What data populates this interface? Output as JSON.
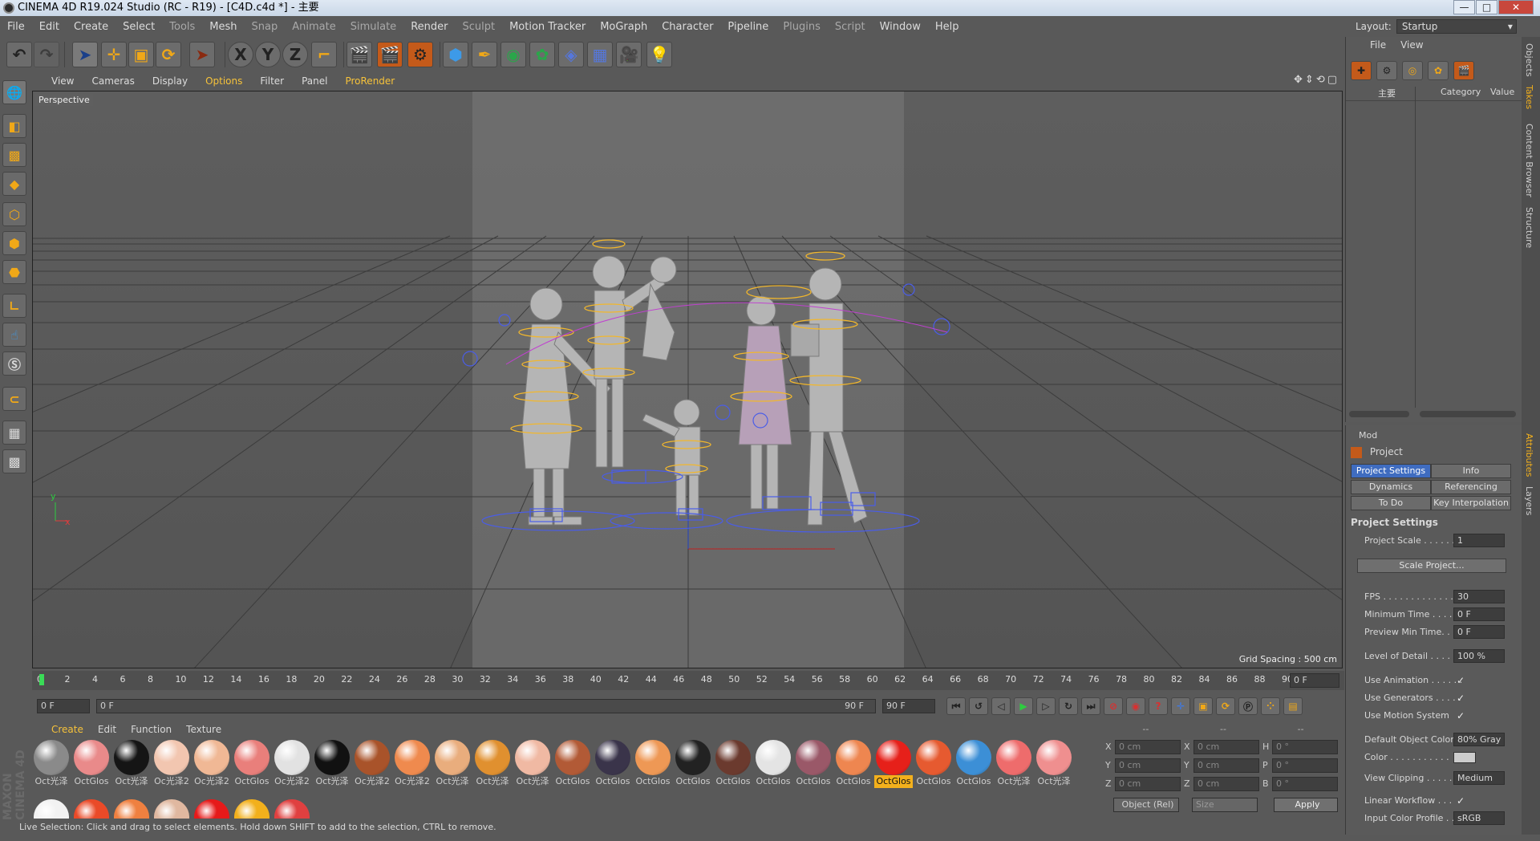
{
  "window": {
    "title": "CINEMA 4D R19.024 Studio (RC - R19) - [C4D.c4d *] - 主要",
    "controls": [
      "—",
      "□",
      "✕"
    ]
  },
  "menubar": {
    "items": [
      "File",
      "Edit",
      "Create",
      "Select",
      "Tools",
      "Mesh",
      "Snap",
      "Animate",
      "Simulate",
      "Render",
      "Sculpt",
      "Motion Tracker",
      "MoGraph",
      "Character",
      "Pipeline",
      "Plugins",
      "Script",
      "Window",
      "Help"
    ],
    "layout_label": "Layout:",
    "layout_value": "Startup"
  },
  "toolbar": {
    "axis_x": "X",
    "axis_y": "Y",
    "axis_z": "Z"
  },
  "viewport": {
    "menu": [
      "View",
      "Cameras",
      "Display",
      "Options",
      "Filter",
      "Panel",
      "ProRender"
    ],
    "camera_label": "Perspective",
    "grid_spacing": "Grid Spacing : 500 cm",
    "axis_y": "y",
    "axis_x": "x"
  },
  "timeline": {
    "ticks": [
      "0",
      "2",
      "4",
      "6",
      "8",
      "10",
      "12",
      "14",
      "16",
      "18",
      "20",
      "22",
      "24",
      "26",
      "28",
      "30",
      "32",
      "34",
      "36",
      "38",
      "40",
      "42",
      "44",
      "46",
      "48",
      "50",
      "52",
      "54",
      "56",
      "58",
      "60",
      "62",
      "64",
      "66",
      "68",
      "70",
      "72",
      "74",
      "76",
      "78",
      "80",
      "82",
      "84",
      "86",
      "88",
      "90"
    ],
    "current_frame": "0 F",
    "start_field": "0 F",
    "range_start": "0 F",
    "range_end": "90 F",
    "end_field": "90 F"
  },
  "material_manager": {
    "menu": [
      "Create",
      "Edit",
      "Function",
      "Texture"
    ],
    "materials": [
      {
        "label": "Oct光泽",
        "color": "#8a8a8a",
        "selected": false
      },
      {
        "label": "OctGlos",
        "color": "#e98a8a",
        "selected": false
      },
      {
        "label": "Oct光泽",
        "color": "#151515",
        "selected": false
      },
      {
        "label": "Oc光泽2",
        "color": "#f2c6b0",
        "selected": false
      },
      {
        "label": "Oc光泽2",
        "color": "#f0b895",
        "selected": false
      },
      {
        "label": "OctGlos",
        "color": "#e97f7b",
        "selected": false
      },
      {
        "label": "Oc光泽2",
        "color": "#e2e2e2",
        "selected": false
      },
      {
        "label": "Oct光泽",
        "color": "#111111",
        "selected": false
      },
      {
        "label": "Oc光泽2",
        "color": "#a9532a",
        "selected": false
      },
      {
        "label": "Oc光泽2",
        "color": "#ef8a4e",
        "selected": false
      },
      {
        "label": "Oct光泽",
        "color": "#e9ad7d",
        "selected": false
      },
      {
        "label": "Oct光泽",
        "color": "#e0902f",
        "selected": false
      },
      {
        "label": "Oct光泽",
        "color": "#f0b9a3",
        "selected": false
      },
      {
        "label": "OctGlos",
        "color": "#b25a36",
        "selected": false
      },
      {
        "label": "OctGlos",
        "color": "#3a344a",
        "selected": false
      },
      {
        "label": "OctGlos",
        "color": "#ee9855",
        "selected": false
      },
      {
        "label": "OctGlos",
        "color": "#222222",
        "selected": false
      },
      {
        "label": "OctGlos",
        "color": "#6b3a2e",
        "selected": false
      },
      {
        "label": "OctGlos",
        "color": "#e4e4e4",
        "selected": false
      },
      {
        "label": "OctGlos",
        "color": "#9a5868",
        "selected": false
      },
      {
        "label": "OctGlos",
        "color": "#ee8650",
        "selected": false
      },
      {
        "label": "OctGlos",
        "color": "#e6201a",
        "selected": true
      },
      {
        "label": "OctGlos",
        "color": "#e65a30",
        "selected": false
      },
      {
        "label": "OctGlos",
        "color": "#3c8fd6",
        "selected": false
      },
      {
        "label": "Oct光泽",
        "color": "#ee6c6c",
        "selected": false
      },
      {
        "label": "Oct光泽",
        "color": "#ef8f8f",
        "selected": false
      }
    ],
    "row2_colors": [
      "#f2f2f2",
      "#ea4a28",
      "#ef8040",
      "#e0b8a0",
      "#e61a1a",
      "#f2b01c",
      "#e04040"
    ]
  },
  "coordinates": {
    "header": [
      "--",
      "--",
      "--"
    ],
    "pos_labels": [
      "X",
      "Y",
      "Z"
    ],
    "size_labels": [
      "X",
      "Y",
      "Z"
    ],
    "rot_labels": [
      "H",
      "P",
      "B"
    ],
    "pos_values": [
      "0 cm",
      "0 cm",
      "0 cm"
    ],
    "size_values": [
      "0 cm",
      "0 cm",
      "0 cm"
    ],
    "rot_values": [
      "0 °",
      "0 °",
      "0 °"
    ],
    "mode_select": "Object (Rel)",
    "size_select": "Size",
    "apply": "Apply"
  },
  "object_manager": {
    "menu": [
      "File",
      "View"
    ],
    "col_name": "主要",
    "col_category": "Category",
    "col_value": "Value"
  },
  "attributes": {
    "menu": "Mod",
    "title": "Project",
    "tabs": [
      "Project Settings",
      "Info",
      "Dynamics",
      "Referencing",
      "To Do",
      "Key Interpolation"
    ],
    "section": "Project Settings",
    "scale_button": "Scale Project...",
    "rows": [
      {
        "label": "Project Scale . . . . . . .",
        "value": "1"
      },
      {
        "label": "FPS . . . . . . . . . . . . . . .",
        "value": "30"
      },
      {
        "label": "Minimum Time . . . . .",
        "value": "0 F"
      },
      {
        "label": "Preview Min Time. . .",
        "value": "0 F"
      },
      {
        "label": "Level of Detail . . . . . .",
        "value": "100 %"
      },
      {
        "label": "Use Animation . . . . . .",
        "value": "✓"
      },
      {
        "label": "Use Generators . . . . .",
        "value": "✓"
      },
      {
        "label": "Use Motion System",
        "value": "✓"
      },
      {
        "label": "Default Object Color",
        "value": "80% Gray"
      },
      {
        "label": "Color . . . . . . . . . . .",
        "value": ""
      },
      {
        "label": "View Clipping . . . . . .",
        "value": "Medium"
      },
      {
        "label": "Linear Workflow . . .",
        "value": "✓"
      },
      {
        "label": "Input Color Profile . .",
        "value": "sRGB"
      }
    ]
  },
  "right_tabs": [
    "Objects",
    "Takes",
    "Content Browser",
    "Structure",
    "Attributes",
    "Layers"
  ],
  "status": "Live Selection: Click and drag to select elements. Hold down SHIFT to add to the selection, CTRL to remove.",
  "brand": "MAXON CINEMA 4D"
}
